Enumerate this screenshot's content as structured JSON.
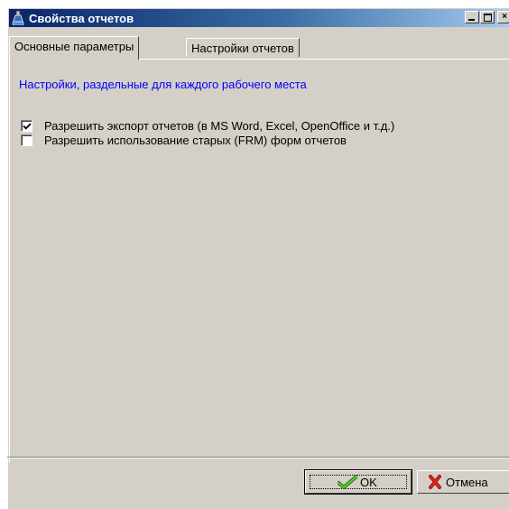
{
  "window": {
    "title": "Свойства отчетов",
    "minimize_glyph": "_",
    "maximize_glyph": "□",
    "close_glyph": "×"
  },
  "tabs": [
    {
      "label": "Основные параметры",
      "active": true
    },
    {
      "label": "Настройки отчетов",
      "active": false
    }
  ],
  "panel": {
    "heading": "Настройки, раздельные для каждого рабочего места",
    "checkboxes": [
      {
        "label": "Разрешить экспорт отчетов (в MS Word, Excel, OpenOffice и т.д.)",
        "checked": true
      },
      {
        "label": "Разрешить использование старых (FRM) форм отчетов",
        "checked": false
      }
    ]
  },
  "buttons": {
    "ok": {
      "label": "OK",
      "icon": "checkmark-icon",
      "icon_color": "#2e8b1e"
    },
    "cancel": {
      "label": "Отмена",
      "icon": "cross-icon",
      "icon_color": "#c81e1e"
    }
  },
  "colors": {
    "title_bar_start": "#0a246a",
    "title_bar_end": "#a6caf0",
    "heading_text": "#0000ff",
    "face": "#d4d0c8"
  }
}
